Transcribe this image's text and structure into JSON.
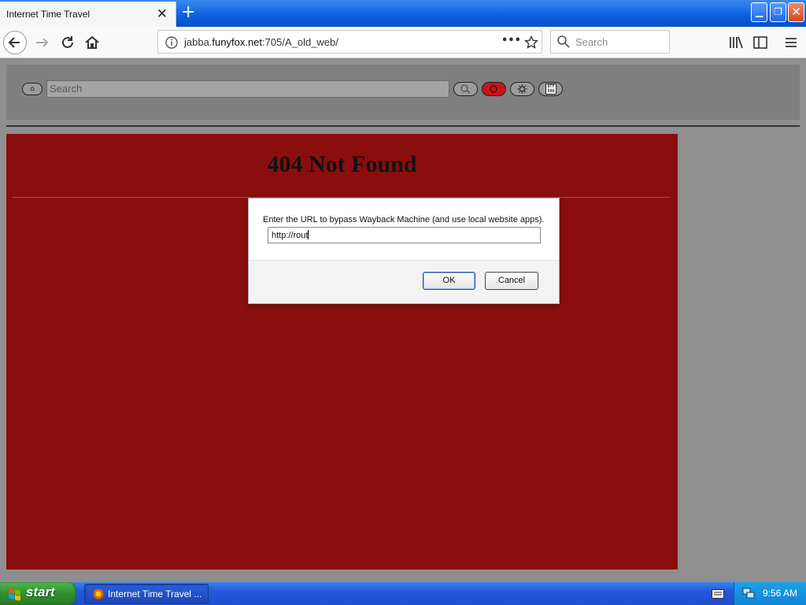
{
  "browser": {
    "tab_title": "Internet Time Travel",
    "tab_close": "✕",
    "new_tab": "+",
    "url_prefix": "jabba.",
    "url_domain": "funyfox.net",
    "url_suffix": ":705/A_old_web/",
    "search_placeholder": "Search",
    "window_buttons": {
      "minimize": "▁",
      "restore": "❐",
      "close": "✕"
    },
    "page_actions_glyph": "•••"
  },
  "page": {
    "toolbar": {
      "home_glyph": "⌂",
      "search_placeholder": "Search",
      "otf_label_top": "OTF",
      "otf_label_bottom": "506"
    },
    "error_title": "404 Not Found"
  },
  "dialog": {
    "message": "Enter the URL to bypass Wayback Machine (and use local website apps).",
    "input_value": "http://rout",
    "ok_label": "OK",
    "cancel_label": "Cancel"
  },
  "taskbar": {
    "start_label": "start",
    "task_label": "Internet Time Travel ...",
    "clock": "9:56 AM"
  },
  "colors": {
    "error_panel": "#8b0e0e",
    "page_background": "#8f8f8f",
    "taskbar_blue": "#2458d8",
    "start_green": "#2e8f2e"
  }
}
